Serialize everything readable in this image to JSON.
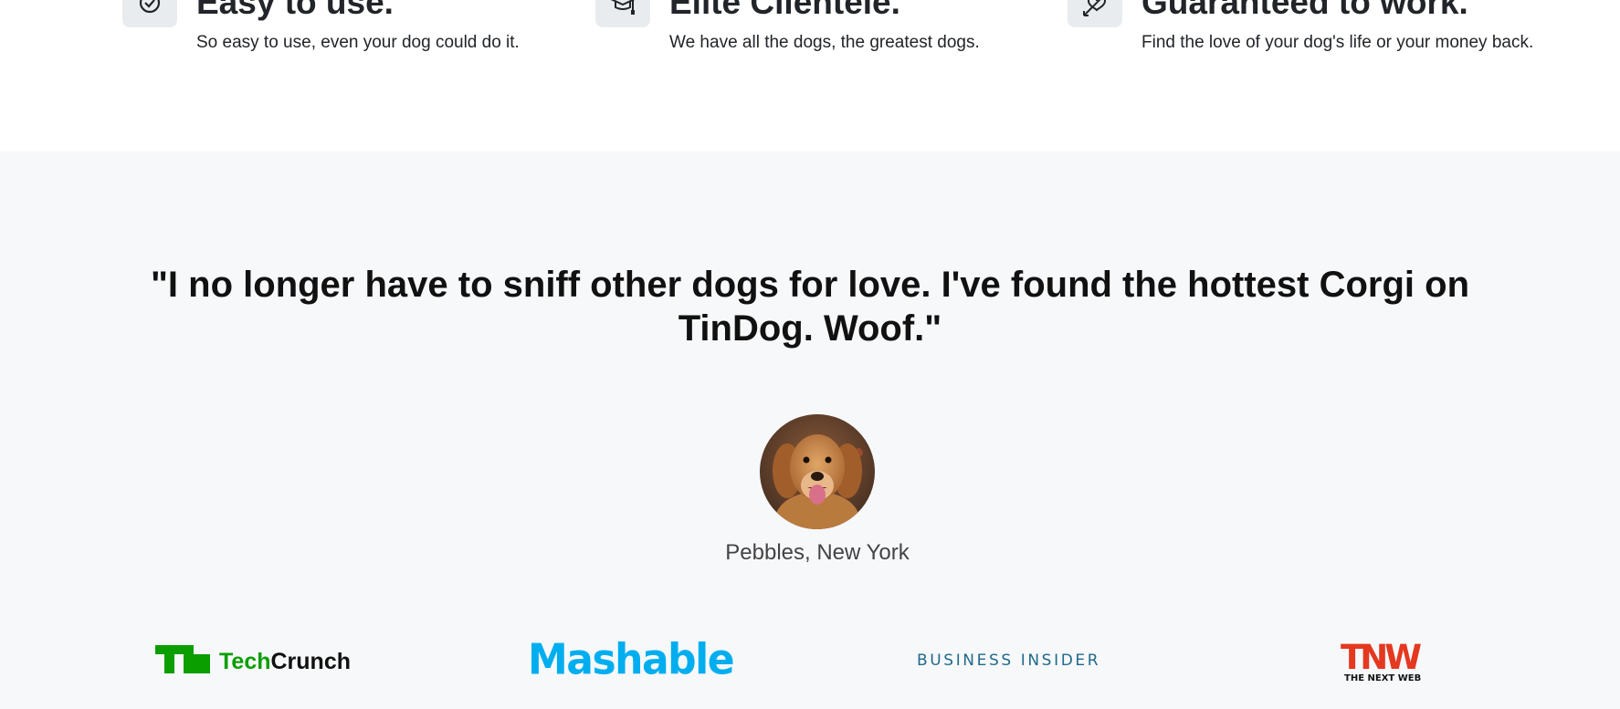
{
  "features": [
    {
      "title": "Easy to use.",
      "description": "So easy to use, even your dog could do it.",
      "icon": "circle-check-icon"
    },
    {
      "title": "Elite Clientele.",
      "description": "We have all the dogs, the greatest dogs.",
      "icon": "graduation-cap-icon"
    },
    {
      "title": "Guaranteed to work.",
      "description": "Find the love of your dog's life or your money back.",
      "icon": "heart-arrow-icon"
    }
  ],
  "testimonial": {
    "quote": "\"I no longer have to sniff other dogs for love. I've found the hottest Corgi on TinDog. Woof.\"",
    "author": "Pebbles, New York",
    "avatar_icon": "dog-avatar-image"
  },
  "press": {
    "techcrunch": {
      "mark": "TC",
      "name_part1": "Tech",
      "name_part2": "Crunch"
    },
    "mashable": "Mashable",
    "business_insider": "BUSINESS INSIDER",
    "tnw": {
      "mark": "TNW",
      "tagline": "THE NEXT WEB"
    }
  },
  "colors": {
    "section_bg": "#f7f8fa",
    "icon_box_bg": "#e9ecef",
    "techcrunch_green": "#0a9e01",
    "mashable_blue": "#00aeef",
    "business_insider_teal": "#1f6a8a",
    "tnw_red": "#e53820"
  }
}
